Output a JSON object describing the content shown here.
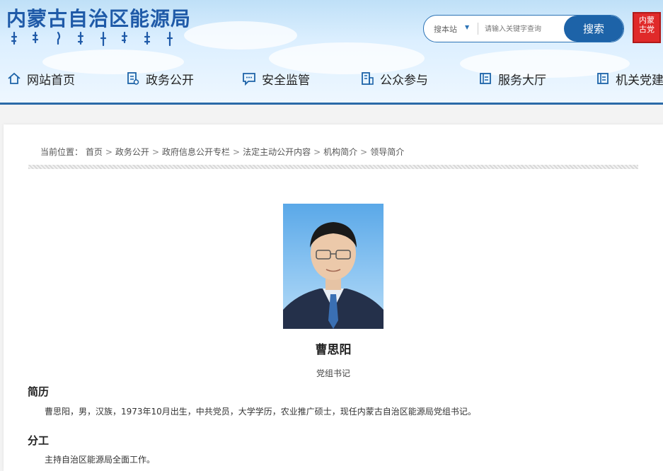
{
  "header": {
    "site_title": "内蒙古自治区能源局",
    "brand_color": "#1f5aa8",
    "search": {
      "scope_label": "搜本站",
      "placeholder": "请输入关键字查询",
      "button_label": "搜索"
    },
    "emblem_icon": "party-emblem-icon"
  },
  "nav": {
    "items": [
      {
        "label": "网站首页",
        "icon": "home-icon"
      },
      {
        "label": "政务公开",
        "icon": "document-icon"
      },
      {
        "label": "安全监管",
        "icon": "chat-icon"
      },
      {
        "label": "公众参与",
        "icon": "people-doc-icon"
      },
      {
        "label": "服务大厅",
        "icon": "book-icon"
      },
      {
        "label": "机关党建",
        "icon": "book-icon"
      }
    ]
  },
  "breadcrumb": {
    "prefix": "当前位置：",
    "items": [
      "首页",
      "政务公开",
      "政府信息公开专栏",
      "法定主动公开内容",
      "机构简介",
      "领导简介"
    ]
  },
  "profile": {
    "name": "曹思阳",
    "position": "党组书记",
    "sections": [
      {
        "heading": "简历",
        "body": "曹思阳，男，汉族，1973年10月出生，中共党员，大学学历，农业推广硕士，现任内蒙古自治区能源局党组书记。"
      },
      {
        "heading": "分工",
        "body": "主持自治区能源局全面工作。"
      }
    ]
  }
}
